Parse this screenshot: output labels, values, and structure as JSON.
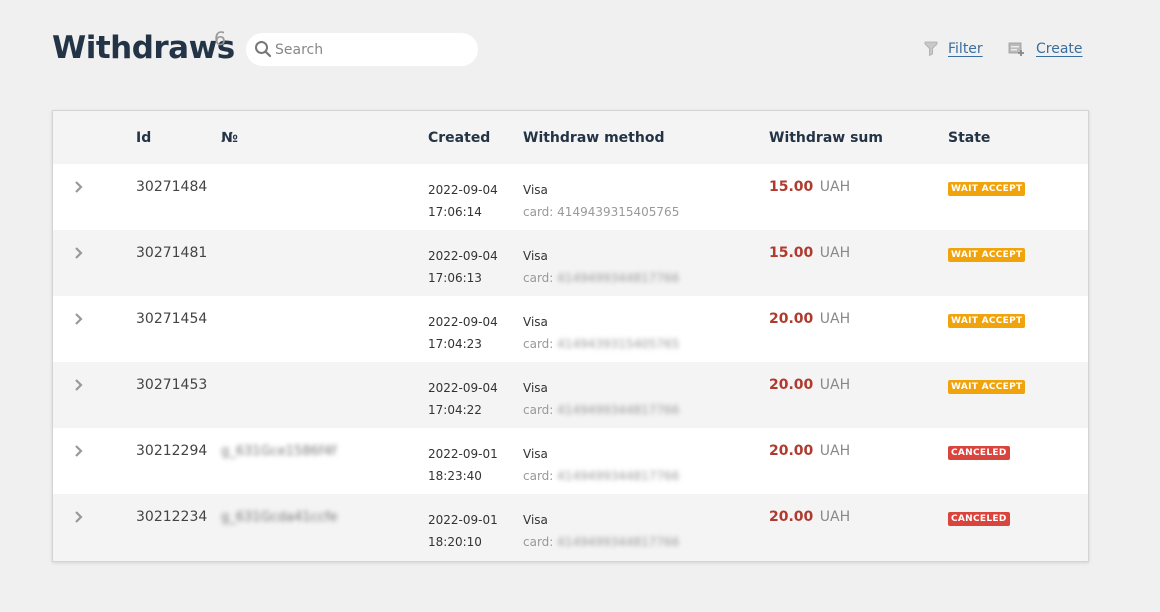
{
  "page": {
    "title": "Withdraws",
    "count": "6"
  },
  "search": {
    "placeholder": "Search",
    "value": ""
  },
  "actions": {
    "filter_label": "Filter",
    "create_label": "Create"
  },
  "table": {
    "columns": [
      "Id",
      "№",
      "Created",
      "Withdraw method",
      "Withdraw sum",
      "State"
    ],
    "rows": [
      {
        "id": "30271484",
        "number": "",
        "date": "2022-09-04",
        "time": "17:06:14",
        "method": "Visa",
        "card_label": "card:",
        "card": "4149439315405765",
        "card_blurred": false,
        "sum": "15.00",
        "currency": "UAH",
        "state": "WAIT ACCEPT",
        "state_kind": "wait"
      },
      {
        "id": "30271481",
        "number": "",
        "date": "2022-09-04",
        "time": "17:06:13",
        "method": "Visa",
        "card_label": "card:",
        "card": "4149499344817766",
        "card_blurred": true,
        "sum": "15.00",
        "currency": "UAH",
        "state": "WAIT ACCEPT",
        "state_kind": "wait"
      },
      {
        "id": "30271454",
        "number": "",
        "date": "2022-09-04",
        "time": "17:04:23",
        "method": "Visa",
        "card_label": "card:",
        "card": "4149439315405765",
        "card_blurred": true,
        "sum": "20.00",
        "currency": "UAH",
        "state": "WAIT ACCEPT",
        "state_kind": "wait"
      },
      {
        "id": "30271453",
        "number": "",
        "date": "2022-09-04",
        "time": "17:04:22",
        "method": "Visa",
        "card_label": "card:",
        "card": "4149499344817766",
        "card_blurred": true,
        "sum": "20.00",
        "currency": "UAH",
        "state": "WAIT ACCEPT",
        "state_kind": "wait"
      },
      {
        "id": "30212294",
        "number": "g_631Gce1586f4f",
        "date": "2022-09-01",
        "time": "18:23:40",
        "method": "Visa",
        "card_label": "card:",
        "card": "4149499344817766",
        "card_blurred": true,
        "sum": "20.00",
        "currency": "UAH",
        "state": "CANCELED",
        "state_kind": "canceled"
      },
      {
        "id": "30212234",
        "number": "g_631Gcda41ccfe",
        "date": "2022-09-01",
        "time": "18:20:10",
        "method": "Visa",
        "card_label": "card:",
        "card": "4149499344817766",
        "card_blurred": true,
        "sum": "20.00",
        "currency": "UAH",
        "state": "CANCELED",
        "state_kind": "canceled"
      }
    ]
  },
  "colors": {
    "background": "#f0f0f0",
    "title": "#243447",
    "link": "#3a6e9e",
    "sum": "#b03a2e",
    "wait_badge": "#f0a30a",
    "canceled_badge": "#d9443c"
  },
  "icons": {
    "search": "search-icon",
    "filter": "funnel-icon",
    "create": "create-icon",
    "expand": "chevron-right-icon"
  }
}
